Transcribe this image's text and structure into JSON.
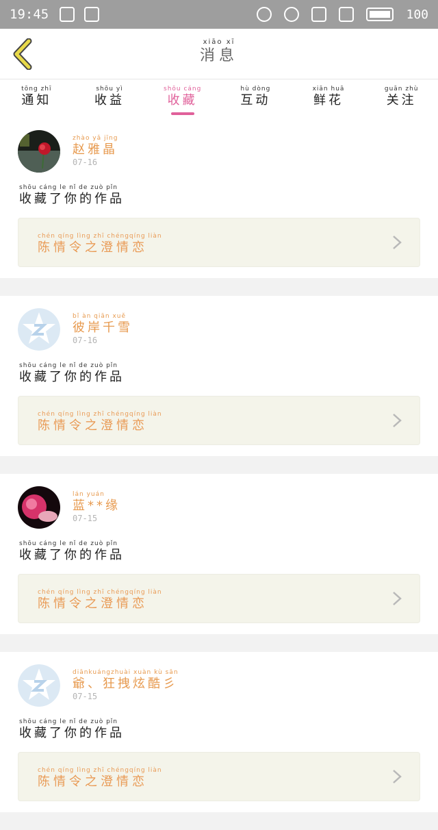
{
  "status_bar": {
    "time": "19:45",
    "battery": "100"
  },
  "header": {
    "title_pinyin": "xiāo  xī",
    "title": "消息"
  },
  "tabs": [
    {
      "pinyin": "tōng  zhī",
      "label": "通知"
    },
    {
      "pinyin": "shōu  yì",
      "label": "收益"
    },
    {
      "pinyin": "shōu cáng",
      "label": "收藏"
    },
    {
      "pinyin": "hù  dòng",
      "label": "互动"
    },
    {
      "pinyin": "xiān  huā",
      "label": "鲜花"
    },
    {
      "pinyin": "guān  zhù",
      "label": "关注"
    }
  ],
  "messages": [
    {
      "user_pinyin": "zhào yǎ jīng",
      "user": "赵雅晶",
      "date": "07-16",
      "action_pinyin": "shōu cáng le  nǐ  de  zuò  pǐn",
      "action": "收藏了你的作品",
      "work_pinyin": "chén qíng lìng zhī chéngqíng liàn",
      "work": "陈情令之澄情恋"
    },
    {
      "user_pinyin": "bǐ  àn  qiān  xuě",
      "user": "彼岸千雪",
      "date": "07-16",
      "action_pinyin": "shōu cáng le  nǐ  de  zuò  pǐn",
      "action": "收藏了你的作品",
      "work_pinyin": "chén qíng lìng zhī chéngqíng liàn",
      "work": "陈情令之澄情恋"
    },
    {
      "user_pinyin": "lán    yuán",
      "user": "蓝**缘",
      "date": "07-15",
      "action_pinyin": "shōu cáng le  nǐ  de  zuò  pǐn",
      "action": "收藏了你的作品",
      "work_pinyin": "chén qíng lìng zhī chéngqíng liàn",
      "work": "陈情令之澄情恋"
    },
    {
      "user_pinyin": "diānkuángzhuài xuàn kù  sān",
      "user": "爺、狂拽炫酷彡",
      "date": "07-15",
      "action_pinyin": "shōu cáng le  nǐ  de  zuò  pǐn",
      "action": "收藏了你的作品",
      "work_pinyin": "chén qíng lìng zhī chéngqíng liàn",
      "work": "陈情令之澄情恋"
    }
  ],
  "colors": {
    "accent_pink": "#e0609a",
    "name_orange": "#e79a4f",
    "back_yellow": "#e8d94a"
  }
}
